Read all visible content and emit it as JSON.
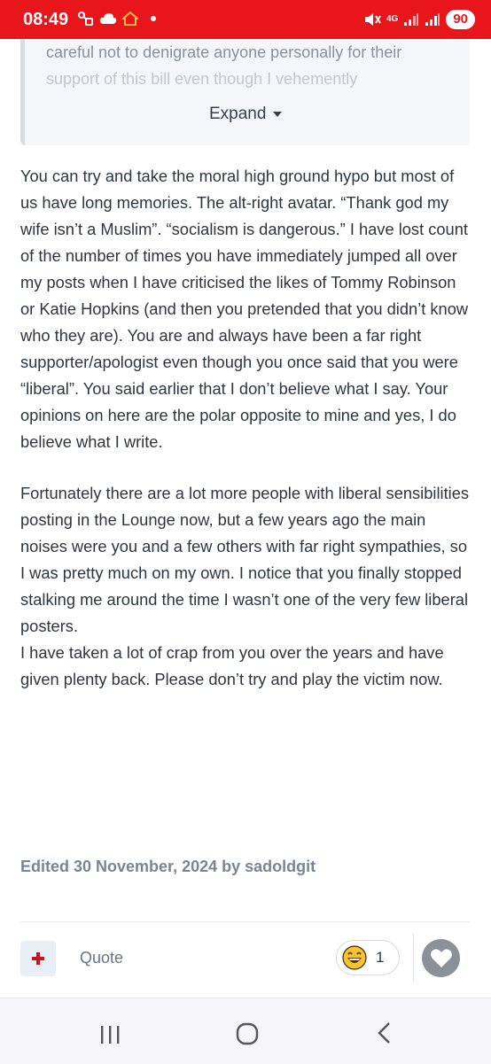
{
  "status_bar": {
    "time": "08:49",
    "network": "4G",
    "battery": "90",
    "bg_color": "#e8161b"
  },
  "quote_block": {
    "line1": "careful not to denigrate anyone personally for their",
    "line2": "support of this bill even though I vehemently",
    "expand_label": "Expand"
  },
  "post": {
    "paragraphs": [
      "You can try and take the moral high ground hypo but most of us have long memories. The alt-right avatar. “Thank god my wife isn’t a Muslim”. “socialism is dangerous.” I have lost count of the number of times you have immediately jumped all over my posts when I have criticised  the likes of Tommy Robinson or Katie Hopkins (and then you pretended that you didn’t know who they are). You are and always have been a far right supporter/apologist even though you once said that you were “liberal”. You said earlier that I don’t believe what I say. Your opinions on here are the polar opposite to mine and yes, I do believe what I write.",
      "Fortunately there are a lot more people with liberal sensibilities posting in the Lounge now, but a few years ago the main noises were you and a few others with far right sympathies, so I was pretty much on my own. I notice that you finally stopped stalking me around the time I wasn’t one of the very few liberal posters.",
      "I have taken a lot of crap from you over the years and have given plenty back. Please don’t try and play the victim now."
    ],
    "edited": "Edited 30 November, 2024 by sadoldgit"
  },
  "actions": {
    "quote_label": "Quote",
    "reaction_count": "1",
    "reaction_icon": "laughing-emoji",
    "like_icon": "heart-icon"
  },
  "nav": {
    "recent_icon": "recent-apps-icon",
    "home_icon": "home-icon",
    "back_icon": "back-icon"
  }
}
